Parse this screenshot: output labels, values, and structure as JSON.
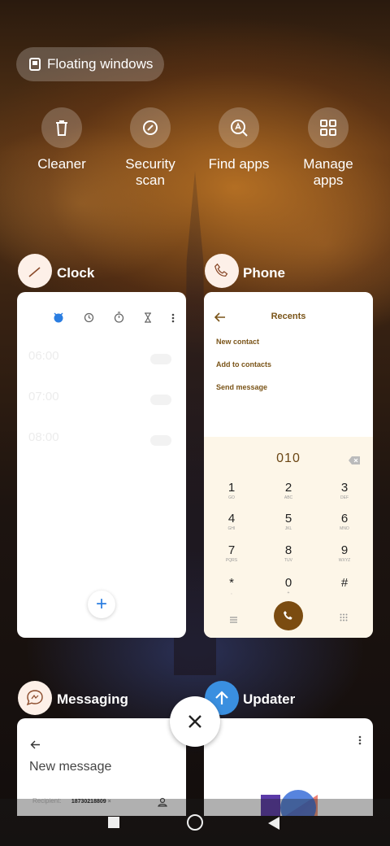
{
  "floating_windows": {
    "label": "Floating windows"
  },
  "quick_actions": [
    {
      "label": "Cleaner",
      "icon": "trash-icon"
    },
    {
      "label": "Security scan",
      "icon": "security-scan-icon"
    },
    {
      "label": "Find apps",
      "icon": "find-apps-icon"
    },
    {
      "label": "Manage apps",
      "icon": "manage-apps-icon"
    }
  ],
  "apps": {
    "clock": {
      "name": "Clock",
      "alarms": [
        {
          "time": "06:00",
          "sub": ""
        },
        {
          "time": "07:00",
          "sub": ""
        },
        {
          "time": "08:00",
          "sub": ""
        }
      ],
      "add_label": "+"
    },
    "phone": {
      "name": "Phone",
      "title": "Recents",
      "links": [
        "New contact",
        "Add to contacts",
        "Send message"
      ],
      "dialed": "010",
      "keys": [
        {
          "d": "1",
          "s": "GO"
        },
        {
          "d": "2",
          "s": "ABC"
        },
        {
          "d": "3",
          "s": "DEF"
        },
        {
          "d": "4",
          "s": "GHI"
        },
        {
          "d": "5",
          "s": "JKL"
        },
        {
          "d": "6",
          "s": "MNO"
        },
        {
          "d": "7",
          "s": "PQRS"
        },
        {
          "d": "8",
          "s": "TUV"
        },
        {
          "d": "9",
          "s": "WXYZ"
        },
        {
          "d": "*",
          "s": ","
        },
        {
          "d": "0",
          "s": "+"
        },
        {
          "d": "#",
          "s": ""
        }
      ]
    },
    "messaging": {
      "name": "Messaging",
      "title": "New message",
      "recipient_label": "Recipient:",
      "recipient_value": "18730218809",
      "recipient_x": "×"
    },
    "updater": {
      "name": "Updater"
    }
  },
  "colors": {
    "phone_accent": "#7b4c11",
    "clock_accent": "#2a7de1",
    "updater_icon": "#3a8fe0"
  }
}
